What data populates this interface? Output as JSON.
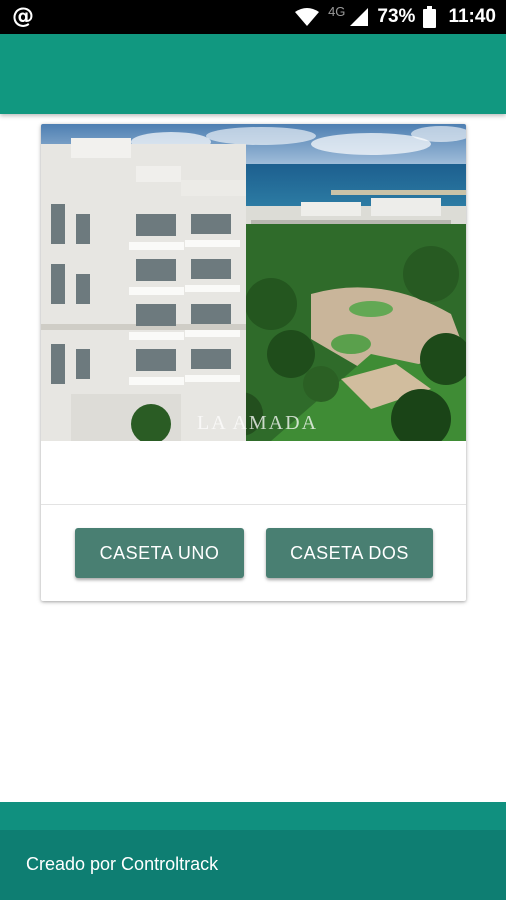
{
  "status_bar": {
    "left_icon": "at-sign-icon",
    "network_type": "4G",
    "battery_percent": "73%",
    "time": "11:40"
  },
  "card": {
    "image_watermark": "LA AMADA",
    "buttons": {
      "caseta_uno": "CASETA UNO",
      "caseta_dos": "CASETA DOS"
    }
  },
  "footer": {
    "credit_text": "Creado por Controltrack"
  },
  "colors": {
    "app_bar": "#119880",
    "button": "#497f72",
    "footer": "#0e7e72"
  }
}
